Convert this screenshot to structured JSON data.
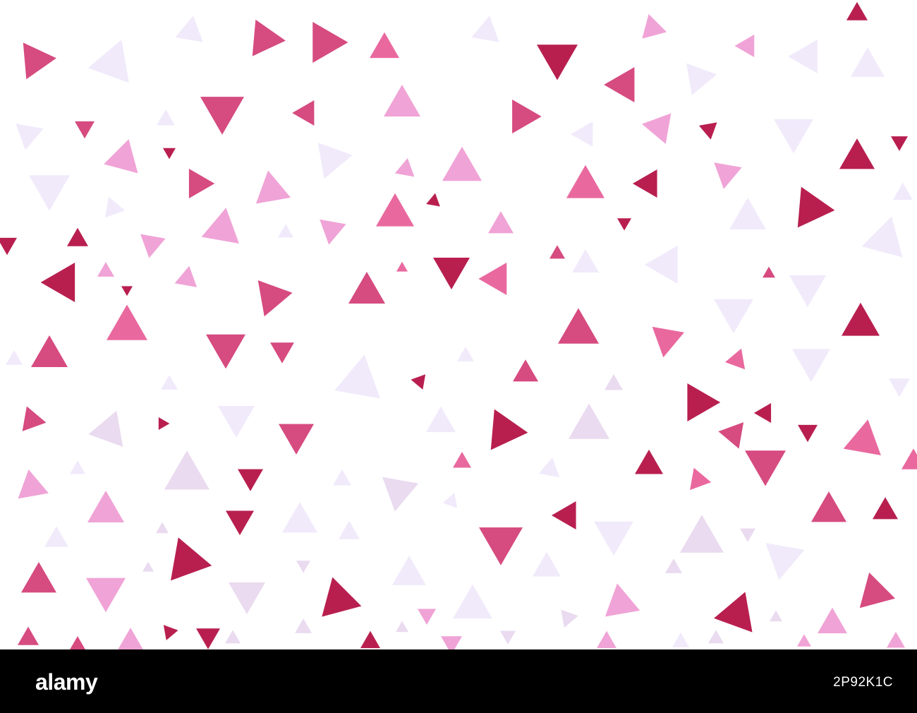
{
  "pattern": {
    "background": "#ffffff",
    "palette": {
      "crimson": "#b81f4f",
      "rose": "#d64b80",
      "pink": "#e9699f",
      "light_pink": "#f0a3d6",
      "lavender": "#eadbf0",
      "pale_lavender": "#f1eafb"
    }
  },
  "watermark": {
    "brand": "alamy",
    "image_id": "2P92K1C",
    "bar_color": "#000000",
    "text_color": "#ffffff"
  }
}
